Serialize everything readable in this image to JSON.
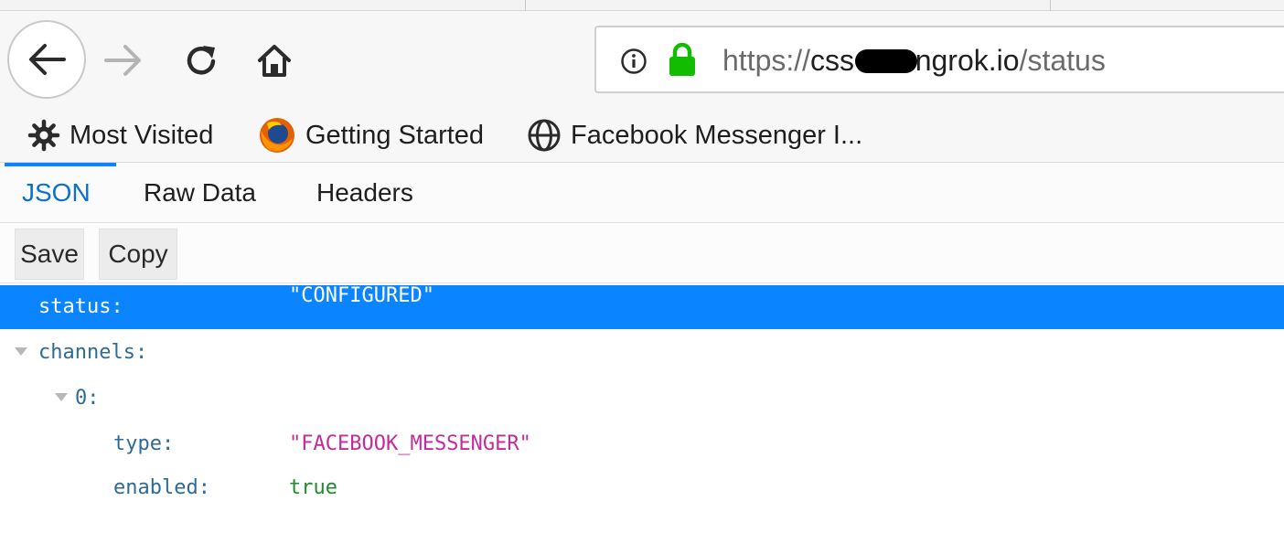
{
  "nav": {
    "url_scheme": "https://",
    "url_host_prefix": "css-",
    "url_host_suffix": "ngrok.io",
    "url_path": "/status"
  },
  "bookmarks": [
    {
      "label": "Most Visited",
      "icon": "gear-icon"
    },
    {
      "label": "Getting Started",
      "icon": "firefox-icon"
    },
    {
      "label": "Facebook Messenger I...",
      "icon": "globe-icon"
    }
  ],
  "viewer_tabs": [
    {
      "label": "JSON",
      "active": true
    },
    {
      "label": "Raw Data",
      "active": false
    },
    {
      "label": "Headers",
      "active": false
    }
  ],
  "toolbar": {
    "save_label": "Save",
    "copy_label": "Copy"
  },
  "json": {
    "status_key": "status:",
    "status_value": "\"CONFIGURED\"",
    "channels_key": "channels:",
    "index_key": "0:",
    "type_key": "type:",
    "type_value": "\"FACEBOOK_MESSENGER\"",
    "enabled_key": "enabled:",
    "enabled_value": "true"
  },
  "colors": {
    "selection": "#0a84ff",
    "json_key": "#2f6b96",
    "json_string": "#c12b9e",
    "json_bool": "#1f8a2e",
    "lock_green": "#12bc00",
    "active_tab": "#0a70d1"
  }
}
